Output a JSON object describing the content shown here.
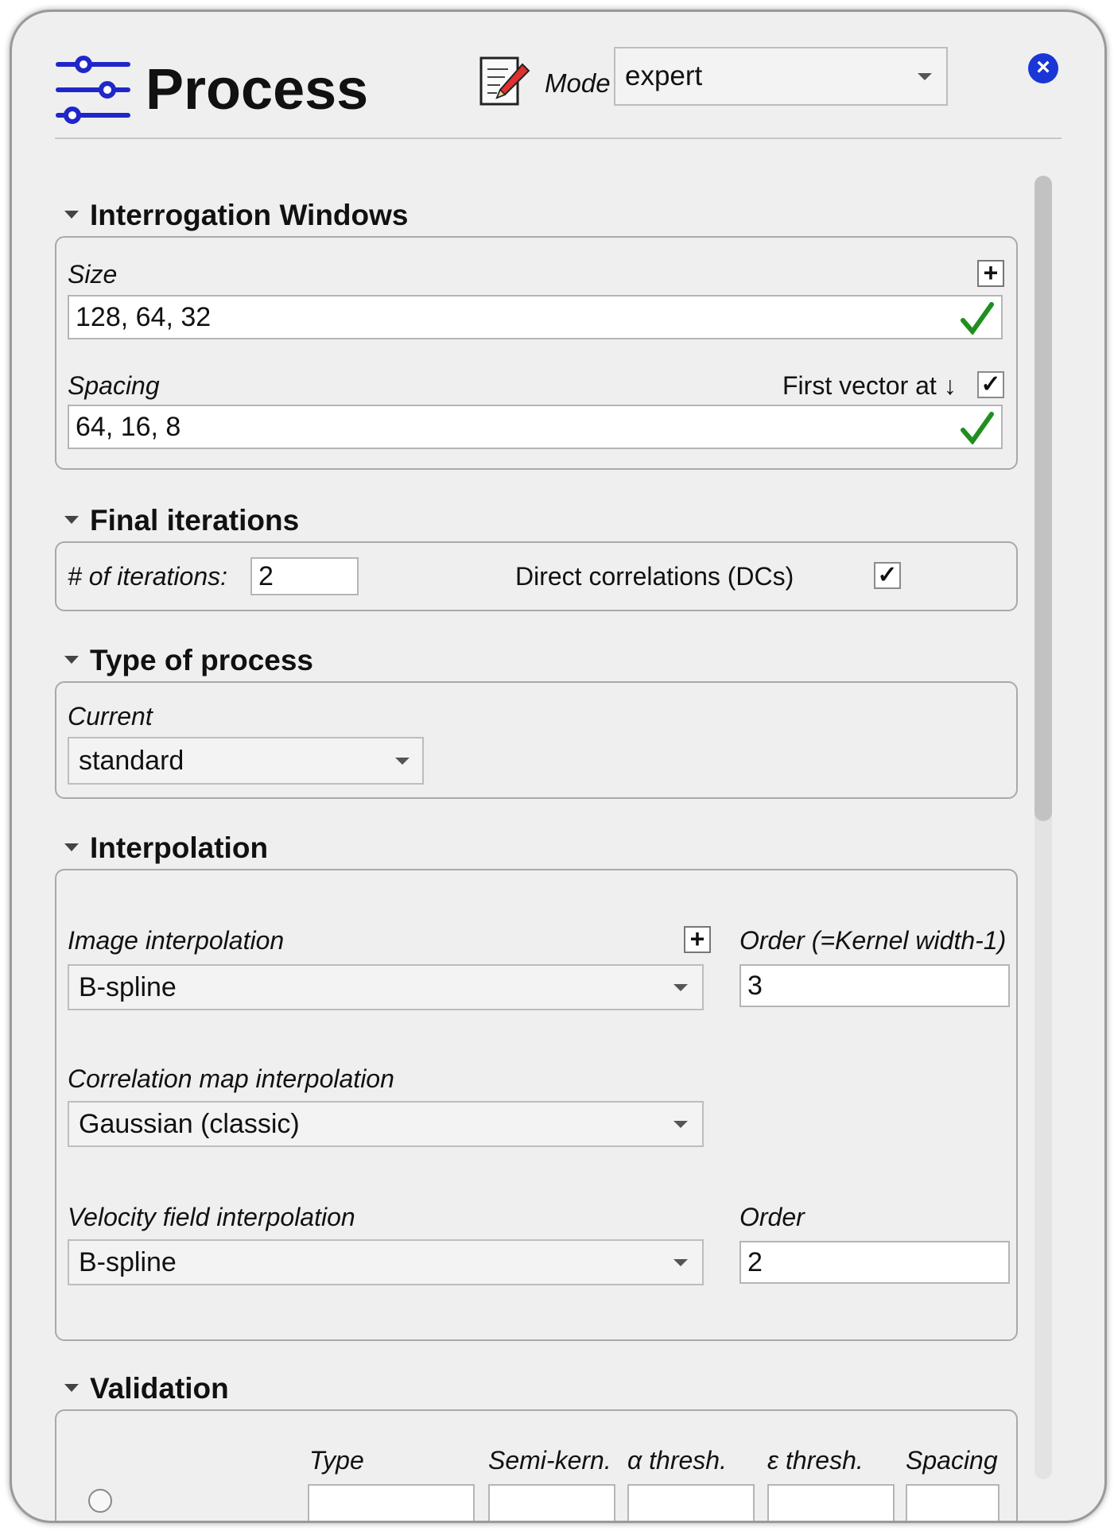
{
  "header": {
    "title": "Process",
    "mode_label": "Mode",
    "mode_value": "expert"
  },
  "interrogation_windows": {
    "title": "Interrogation Windows",
    "size_label": "Size",
    "size_value": "128, 64, 32",
    "spacing_label": "Spacing",
    "first_vector_label": "First vector at ↓",
    "first_vector_checked": true,
    "spacing_value": "64, 16, 8"
  },
  "final_iterations": {
    "title": "Final iterations",
    "iterations_label": "# of iterations:",
    "iterations_value": "2",
    "dcs_label": "Direct correlations (DCs)",
    "dcs_checked": true
  },
  "type_of_process": {
    "title": "Type of process",
    "current_label": "Current",
    "current_value": "standard"
  },
  "interpolation": {
    "title": "Interpolation",
    "image_label": "Image interpolation",
    "image_value": "B-spline",
    "order_kernel_label": "Order (=Kernel width-1)",
    "order_kernel_value": "3",
    "correlation_label": "Correlation map interpolation",
    "correlation_value": "Gaussian (classic)",
    "velocity_label": "Velocity field interpolation",
    "velocity_value": "B-spline",
    "velocity_order_label": "Order",
    "velocity_order_value": "2"
  },
  "validation": {
    "title": "Validation",
    "columns": [
      "Type",
      "Semi-kern.",
      "α thresh.",
      "ε thresh.",
      "Spacing"
    ]
  },
  "colors": {
    "accent": "#1a36d6",
    "check_green": "#1f8f1f",
    "background": "#efefef"
  }
}
